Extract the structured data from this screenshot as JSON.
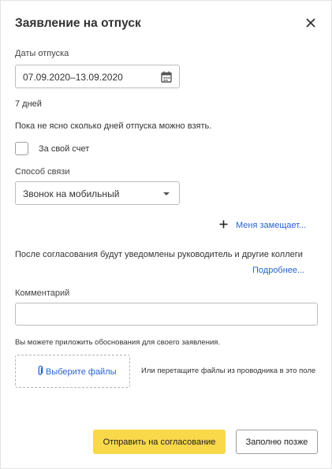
{
  "dialog": {
    "title": "Заявление на отпуск"
  },
  "dates": {
    "label": "Даты отпуска",
    "value": "07.09.2020–13.09.2020",
    "duration": "7 дней",
    "note": "Пока не ясно сколько дней отпуска можно взять."
  },
  "own_expense": {
    "label": "За свой счет",
    "checked": false
  },
  "contact": {
    "label": "Способ связи",
    "selected": "Звонок на мобильный"
  },
  "substitute": {
    "link": "Меня замещает..."
  },
  "notification": {
    "text": "После согласования будут уведомлены руководитель и другие коллеги",
    "more_link": "Подробнее..."
  },
  "comment": {
    "label": "Комментарий",
    "value": ""
  },
  "attachments": {
    "hint": "Вы можете приложить обоснования для своего заявления.",
    "choose_link": "Выберите файлы",
    "drop_hint": "Или перетащите файлы из проводника в это поле"
  },
  "actions": {
    "submit": "Отправить на согласование",
    "later": "Заполню позже"
  },
  "colors": {
    "accent_button": "#f9d84a",
    "link": "#2a63d6"
  },
  "icons": [
    "close-icon",
    "calendar-icon",
    "chevron-down-icon",
    "plus-icon",
    "paperclip-icon"
  ]
}
